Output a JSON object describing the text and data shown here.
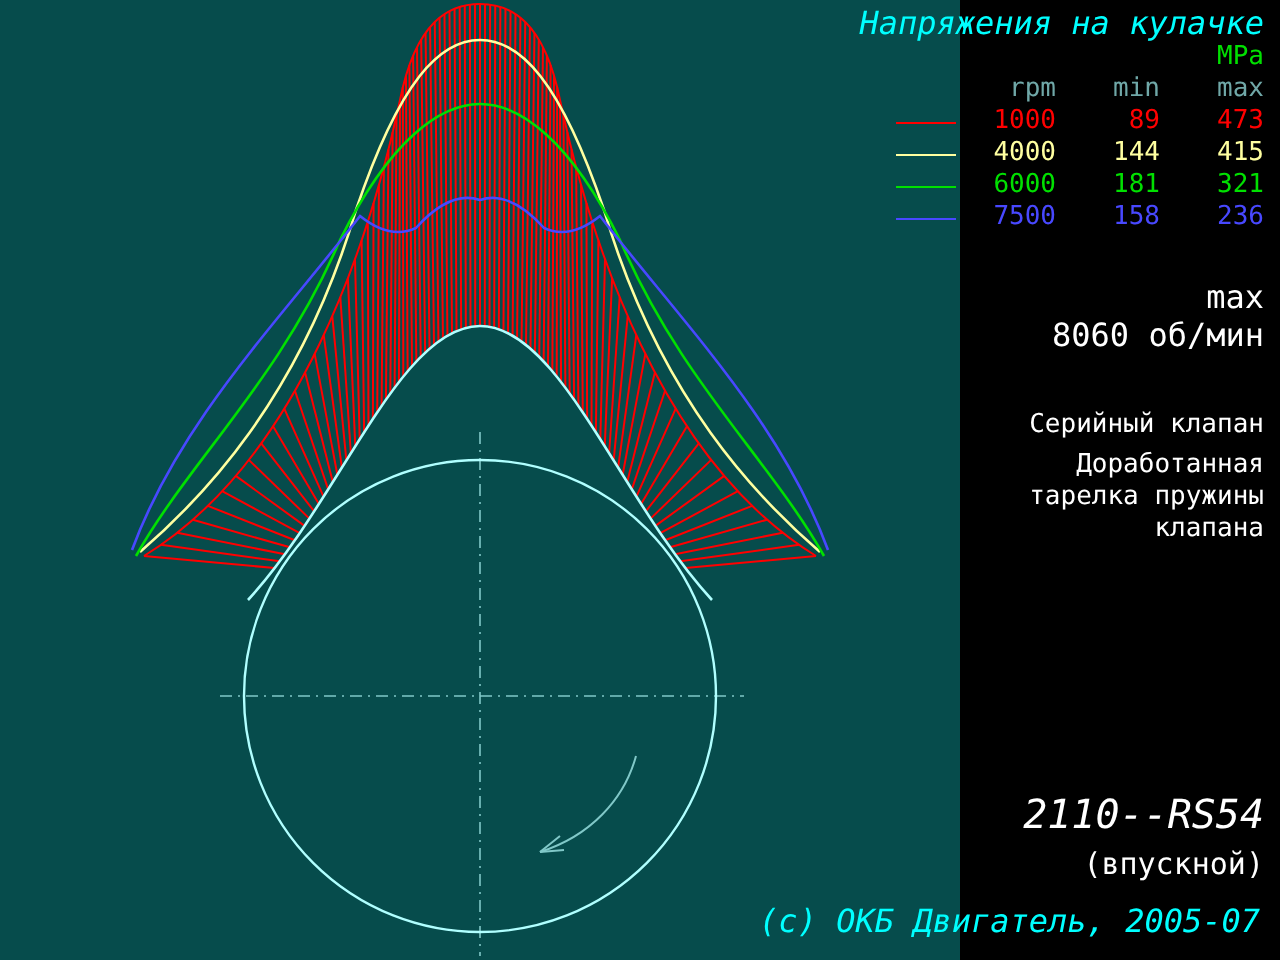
{
  "title": "Напряжения на кулачке",
  "legend": {
    "unit": "MPa",
    "columns": [
      "rpm",
      "min",
      "max"
    ],
    "rows": [
      {
        "rpm": "1000",
        "min": "89",
        "max": "473",
        "color": "#ff0000"
      },
      {
        "rpm": "4000",
        "min": "144",
        "max": "415",
        "color": "#ffffa0"
      },
      {
        "rpm": "6000",
        "min": "181",
        "max": "321",
        "color": "#00e000"
      },
      {
        "rpm": "7500",
        "min": "158",
        "max": "236",
        "color": "#4848ff"
      }
    ]
  },
  "max_speed": {
    "label": "max",
    "value": "8060 об/мин"
  },
  "notes": [
    "Серийный клапан",
    "Доработанная тарелка пружины клапана"
  ],
  "engine": {
    "model": "2110--RS54",
    "type": "(впускной)"
  },
  "footer": "(c) ОКБ Двигатель, 2005-07"
}
